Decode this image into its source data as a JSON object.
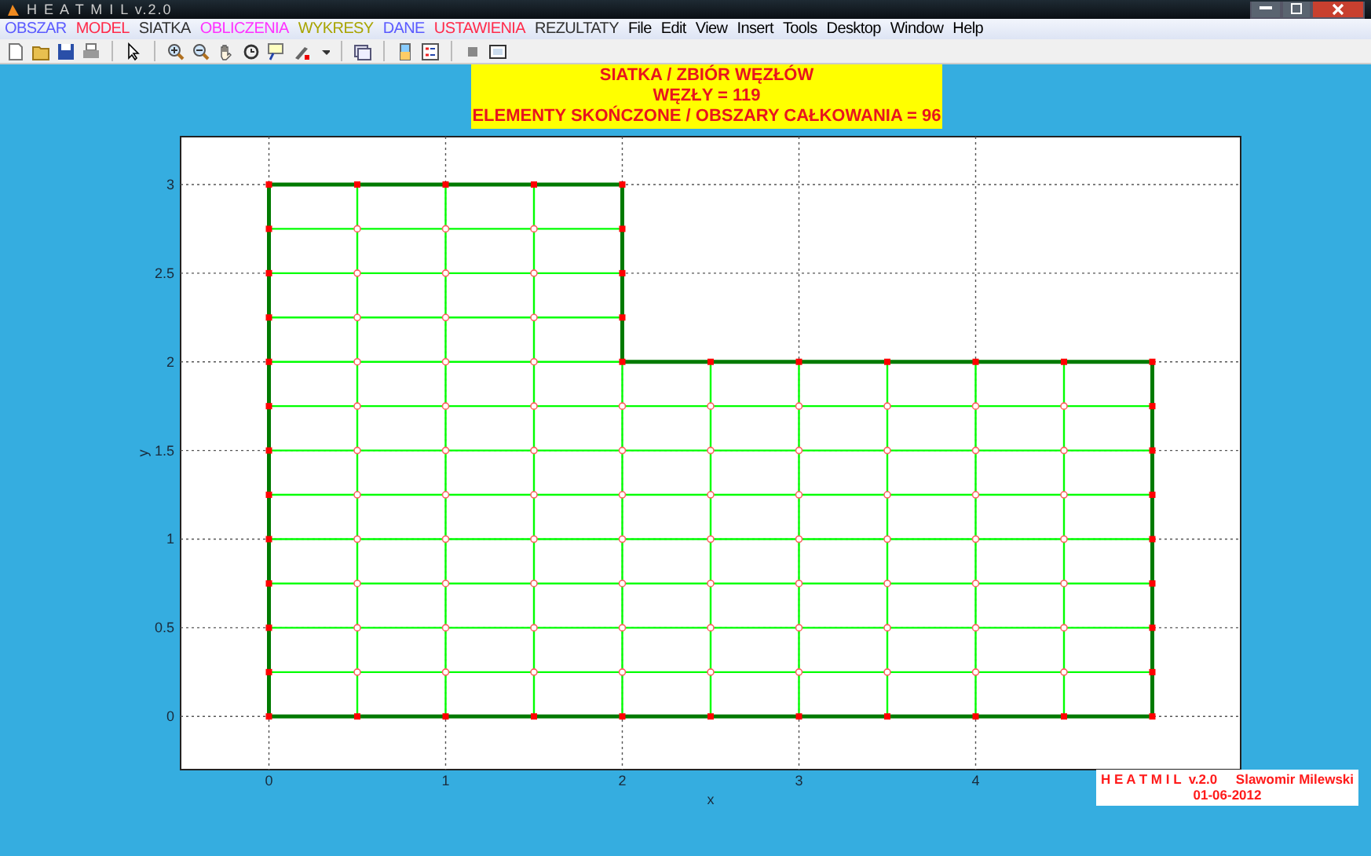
{
  "window": {
    "title": "H E A T M I L    v.2.0"
  },
  "menu": [
    {
      "label": "OBSZAR",
      "color": "#5a5aff"
    },
    {
      "label": "MODEL",
      "color": "#ff2a4a"
    },
    {
      "label": "SIATKA",
      "color": "#303030"
    },
    {
      "label": "OBLICZENIA",
      "color": "#ff30ff"
    },
    {
      "label": "WYKRESY",
      "color": "#a8a400"
    },
    {
      "label": "DANE",
      "color": "#5a5aff"
    },
    {
      "label": "USTAWIENIA",
      "color": "#ff2a4a"
    },
    {
      "label": "REZULTATY",
      "color": "#303030"
    },
    {
      "label": "File",
      "color": "#000000"
    },
    {
      "label": "Edit",
      "color": "#000000"
    },
    {
      "label": "View",
      "color": "#000000"
    },
    {
      "label": "Insert",
      "color": "#000000"
    },
    {
      "label": "Tools",
      "color": "#000000"
    },
    {
      "label": "Desktop",
      "color": "#000000"
    },
    {
      "label": "Window",
      "color": "#000000"
    },
    {
      "label": "Help",
      "color": "#000000"
    }
  ],
  "plot": {
    "title_lines": [
      "SIATKA / ZBIÓR WĘZŁÓW",
      "WĘZŁY = 119",
      "ELEMENTY SKOŃCZONE / OBSZARY CAŁKOWANIA = 96"
    ],
    "chart_data": {
      "type": "line",
      "xlabel": "x",
      "ylabel": "y",
      "xlim": [
        -0.5,
        5.5
      ],
      "ylim": [
        -0.3,
        3.27
      ],
      "xticks": [
        0,
        1,
        2,
        3,
        4
      ],
      "yticks": [
        0,
        0.5,
        1,
        1.5,
        2,
        2.5,
        3
      ],
      "grid": true
    }
  },
  "footer": {
    "line_1": "H E A T M I L  v.2.0     Slawomir Milewski",
    "line_2": "01-06-2012"
  }
}
